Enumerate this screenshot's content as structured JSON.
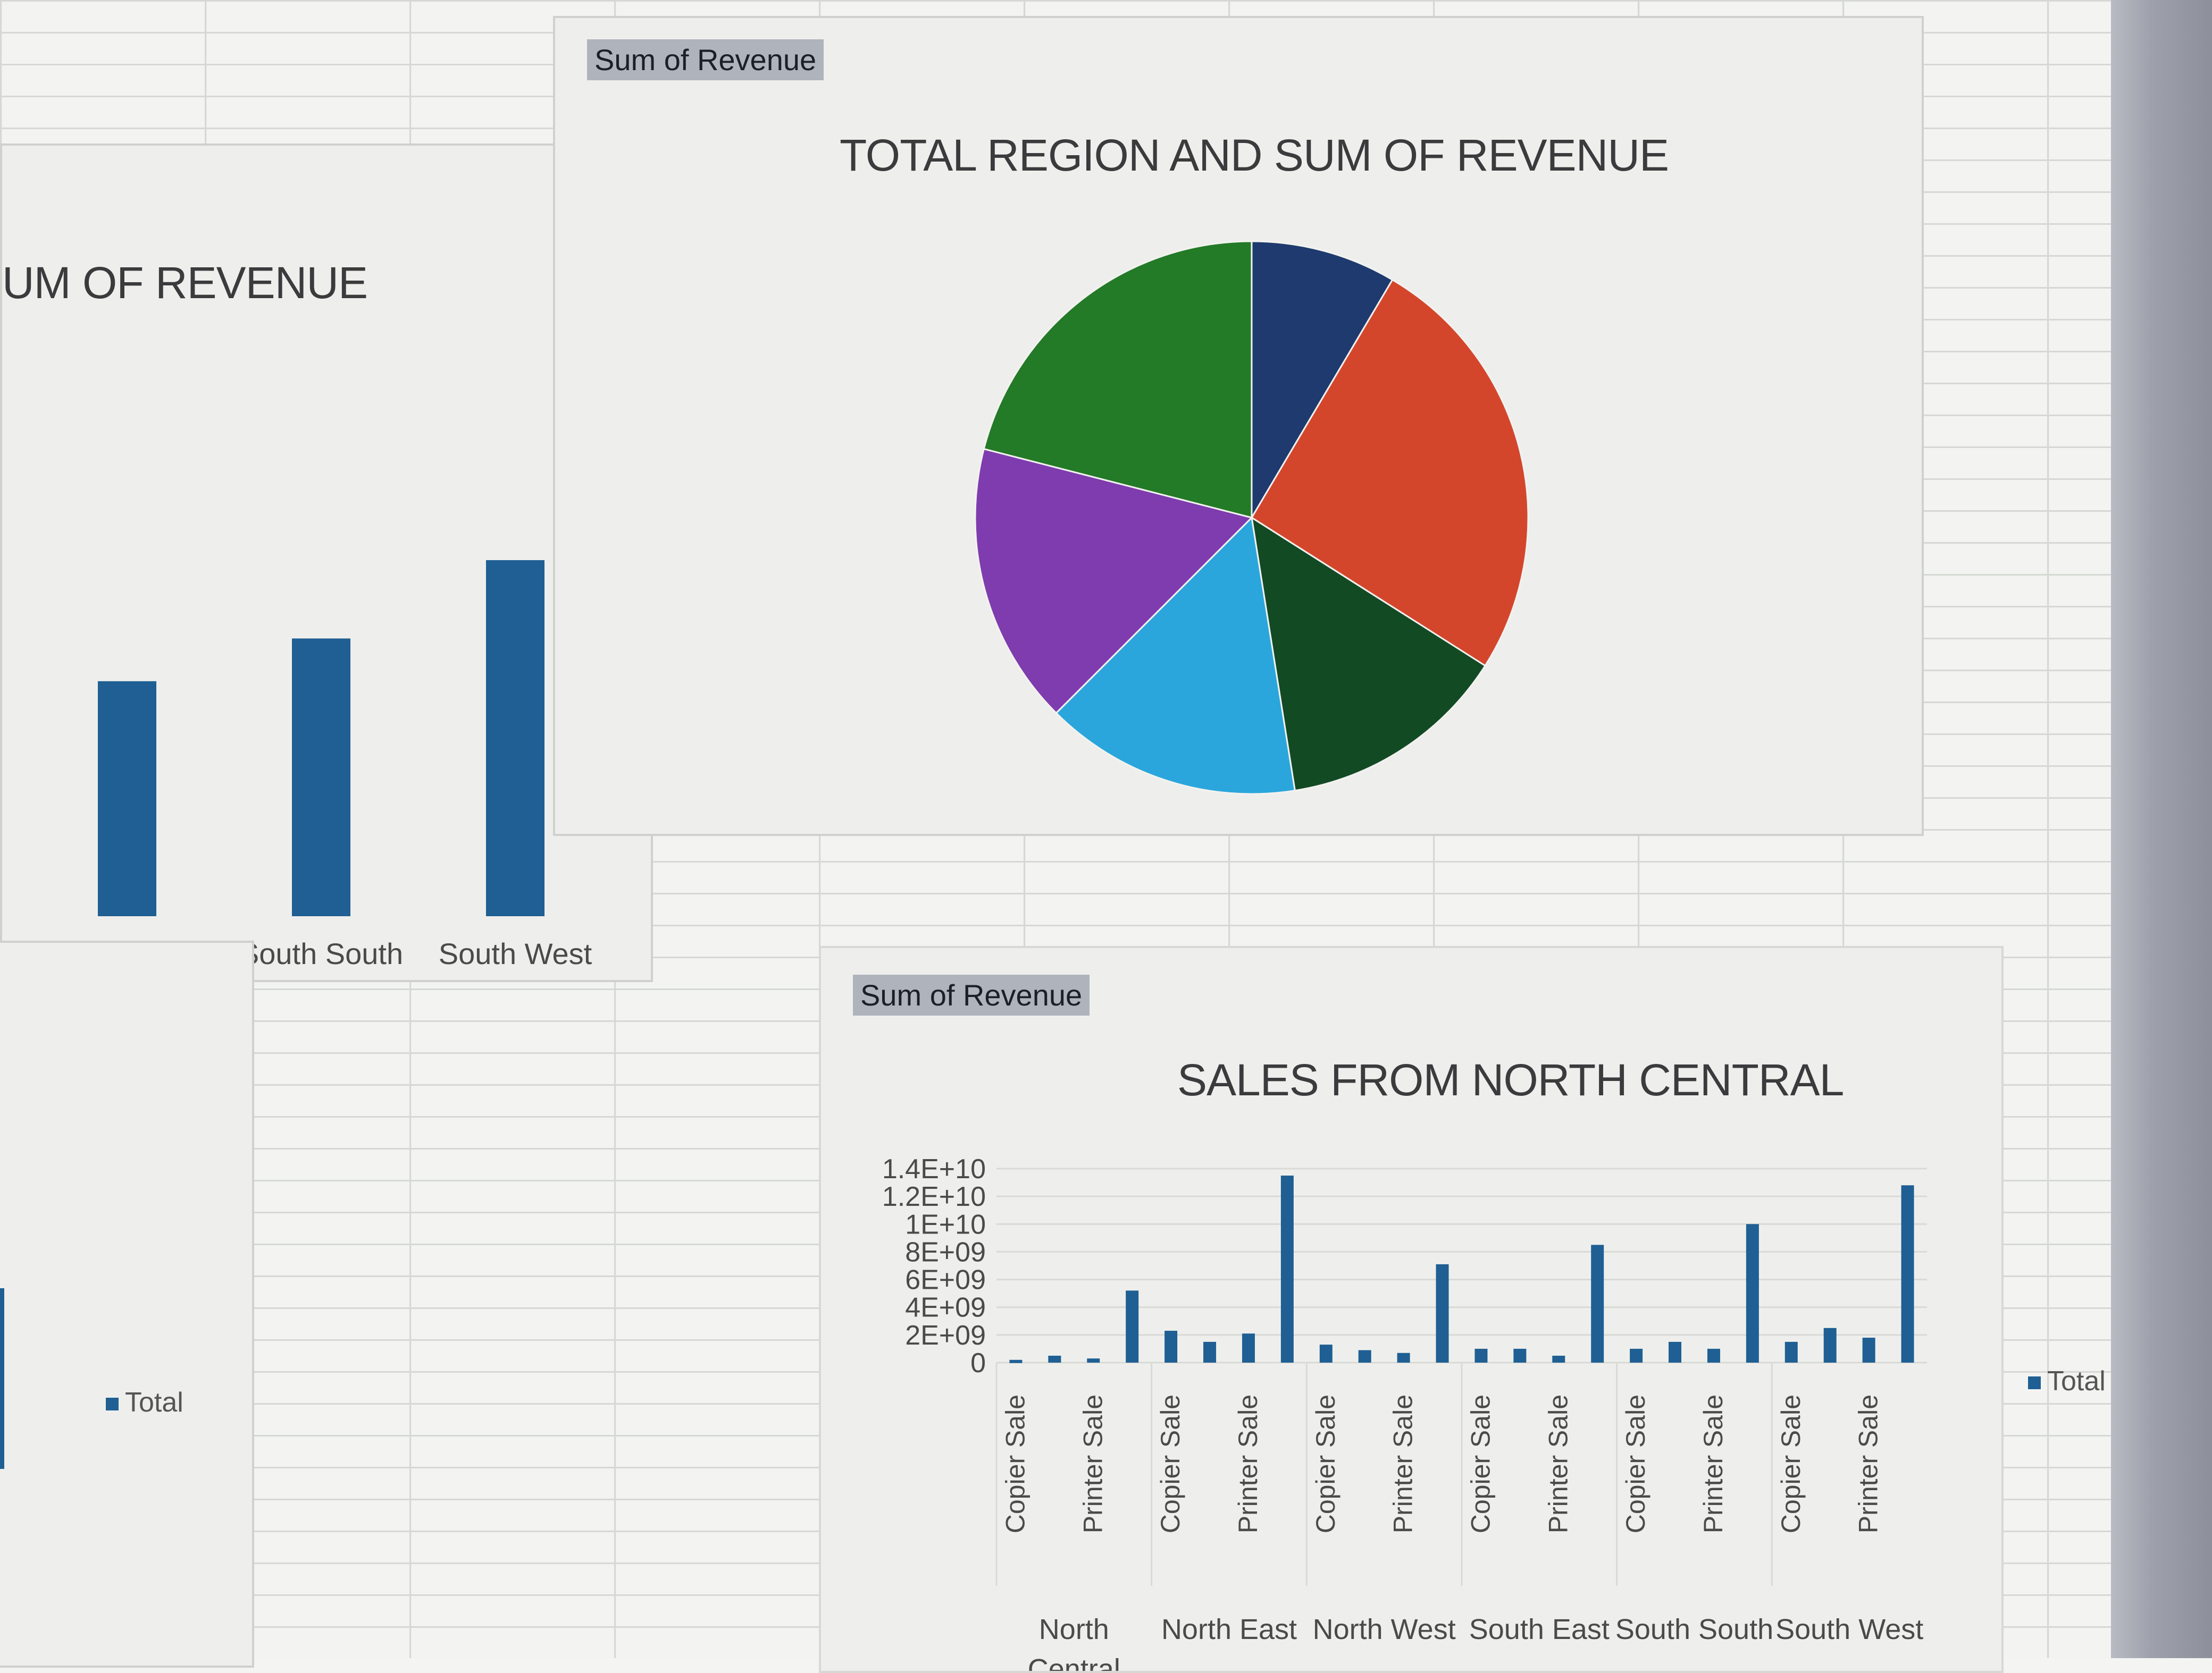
{
  "sheet": {
    "colors": {
      "grid": "#d6d8d4",
      "bar": "#1f5f93"
    }
  },
  "pie_chart": {
    "tag": "Sum of Revenue",
    "title": "TOTAL REGION AND SUM OF REVENUE"
  },
  "region_bar_chart": {
    "title": "UM OF REVENUE",
    "legend_label": "Total"
  },
  "north_central_chart": {
    "tag": "Sum of Revenue",
    "title": "SALES FROM NORTH CENTRAL",
    "legend_label": "Total"
  },
  "chart_data": [
    {
      "type": "pie",
      "title": "TOTAL REGION AND SUM OF REVENUE",
      "slices": [
        {
          "value": 8.5,
          "color": "#1e3a6e"
        },
        {
          "value": 25.5,
          "color": "#d4462c"
        },
        {
          "value": 13.5,
          "color": "#124a24"
        },
        {
          "value": 15.0,
          "color": "#2aa6dc"
        },
        {
          "value": 16.5,
          "color": "#7f3cae"
        },
        {
          "value": 21.0,
          "color": "#237a27"
        }
      ]
    },
    {
      "type": "bar",
      "title": "UM OF REVENUE",
      "categories": [
        "",
        "South South",
        "South West"
      ],
      "values": [
        0.66,
        0.78,
        1.0
      ],
      "legend": [
        "Total"
      ]
    },
    {
      "type": "bar",
      "title": "SALES FROM NORTH CENTRAL",
      "ylim": [
        0,
        14000000000
      ],
      "yticks": [
        "0",
        "2E+09",
        "4E+09",
        "6E+09",
        "8E+09",
        "1E+10",
        "1.2E+10",
        "1.4E+10"
      ],
      "groups": [
        {
          "label": "North Central",
          "values": [
            200000000,
            500000000,
            300000000,
            5200000000
          ]
        },
        {
          "label": "North East",
          "values": [
            2300000000,
            1500000000,
            2100000000,
            13500000000
          ]
        },
        {
          "label": "North West",
          "values": [
            1300000000,
            900000000,
            700000000,
            7100000000
          ]
        },
        {
          "label": "South East",
          "values": [
            1000000000,
            1000000000,
            500000000,
            8500000000
          ]
        },
        {
          "label": "South South",
          "values": [
            1000000000,
            1500000000,
            1000000000,
            10000000000
          ]
        },
        {
          "label": "South West",
          "values": [
            1500000000,
            2500000000,
            1800000000,
            12800000000
          ]
        }
      ],
      "rotated_labels": [
        "Copier Sale",
        "Printer Sale",
        "Copier Sale",
        "Printer Sale",
        "Copier Sale",
        "Printer Sale",
        "Copier Sale",
        "Printer Sale",
        "Copier Sale",
        "Printer Sale",
        "Copier Sale",
        "Printer Sale"
      ],
      "legend": [
        "Total"
      ]
    }
  ]
}
